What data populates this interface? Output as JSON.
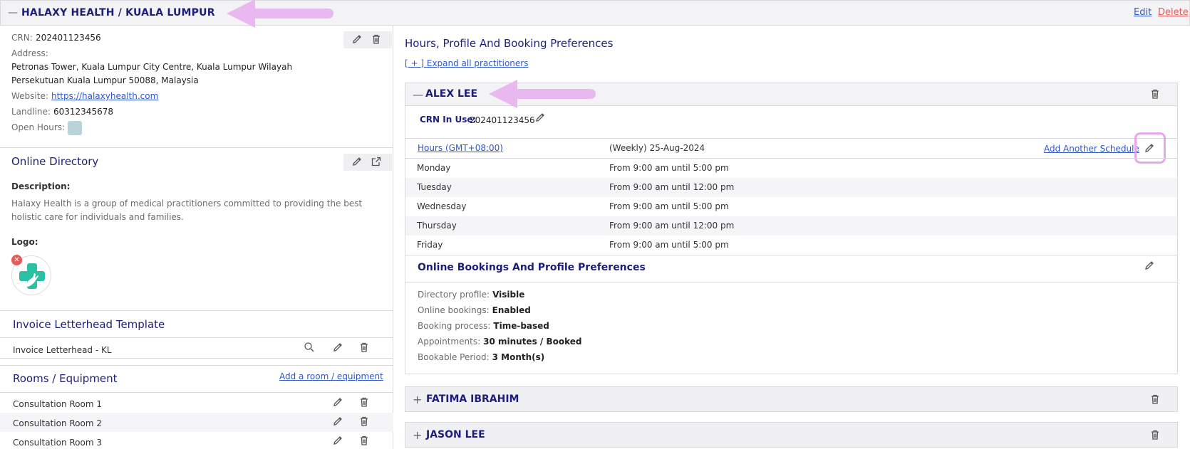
{
  "header": {
    "collapse_symbol": "—",
    "title": "HALAXY HEALTH / KUALA LUMPUR",
    "edit": "Edit",
    "delete": "Delete"
  },
  "location": {
    "crn_label": "CRN:",
    "crn_value": "202401123456",
    "address_label": "Address:",
    "address_line1": "Petronas Tower, Kuala Lumpur City Centre, Kuala Lumpur Wilayah",
    "address_line2": "Persekutuan Kuala Lumpur 50088, Malaysia",
    "website_label": "Website:",
    "website_value": "https://halaxyhealth.com",
    "landline_label": "Landline:",
    "landline_value": "60312345678",
    "open_hours_label": "Open Hours:"
  },
  "directory": {
    "title": "Online Directory",
    "description_label": "Description:",
    "description_line1": "Halaxy Health is a group of medical practitioners committed to providing the best",
    "description_line2": "holistic care for individuals and families.",
    "logo_label": "Logo:"
  },
  "invoice": {
    "title": "Invoice Letterhead Template",
    "item": "Invoice Letterhead - KL"
  },
  "rooms": {
    "title": "Rooms / Equipment",
    "add_link": "Add a room / equipment",
    "items": [
      "Consultation Room 1",
      "Consultation Room 2",
      "Consultation Room 3"
    ]
  },
  "right": {
    "title": "Hours, Profile And Booking Preferences",
    "expand_all": "[ + ] Expand all practitioners"
  },
  "practitioners": [
    {
      "sign": "—",
      "name": "ALEX LEE",
      "crn_label": "CRN In Use:",
      "crn_value": "202401123456",
      "hours_link": "Hours (GMT+08:00)",
      "schedule": "(Weekly) 25-Aug-2024",
      "add_schedule": "Add Another Schedule",
      "hours": [
        {
          "day": "Monday",
          "time": "From 9:00 am until 5:00 pm"
        },
        {
          "day": "Tuesday",
          "time": "From 9:00 am until 12:00 pm"
        },
        {
          "day": "Wednesday",
          "time": "From 9:00 am until 5:00 pm"
        },
        {
          "day": "Thursday",
          "time": "From 9:00 am until 12:00 pm"
        },
        {
          "day": "Friday",
          "time": "From 9:00 am until 5:00 pm"
        }
      ],
      "prefs_title": "Online Bookings And Profile Preferences",
      "prefs": [
        {
          "label": "Directory profile:",
          "value": "Visible"
        },
        {
          "label": "Online bookings:",
          "value": "Enabled"
        },
        {
          "label": "Booking process:",
          "value": "Time-based"
        },
        {
          "label": "Appointments:",
          "value": "30 minutes / Booked"
        },
        {
          "label": "Bookable Period:",
          "value": "3 Month(s)"
        }
      ]
    },
    {
      "sign": "+",
      "name": "FATIMA IBRAHIM"
    },
    {
      "sign": "+",
      "name": "JASON LEE"
    }
  ],
  "colors": {
    "accent_navy": "#1c1f7a",
    "link_blue": "#2f57c9",
    "delete_red": "#e35b5b",
    "annotation_pink": "#eab8f0",
    "open_hours_swatch": "#b9d4d9",
    "logo_green": "#2bbfa4"
  }
}
